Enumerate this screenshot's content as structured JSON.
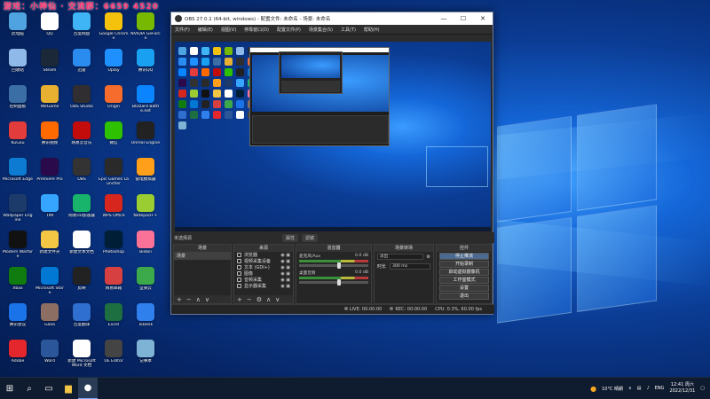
{
  "overlay": {
    "text": "游戏：小神仙 · 交流群：6659 4520"
  },
  "desktop": {
    "icons": [
      {
        "label": "此电脑",
        "color": "#4fa3e0"
      },
      {
        "label": "QQ",
        "color": "#ffffff"
      },
      {
        "label": "百度网盘",
        "color": "#3fb5f5"
      },
      {
        "label": "Google Chrome",
        "color": "#f4c20d"
      },
      {
        "label": "NVIDIA GeForce",
        "color": "#76b900"
      },
      {
        "label": "回收站",
        "color": "#8fb9e8"
      },
      {
        "label": "Steam",
        "color": "#1b2838"
      },
      {
        "label": "迅雷",
        "color": "#2b8cf0"
      },
      {
        "label": "Uplay",
        "color": "#1e90ff"
      },
      {
        "label": "腾讯QQ",
        "color": "#1aa0f0"
      },
      {
        "label": "控制面板",
        "color": "#3a6ea5"
      },
      {
        "label": "WeGame",
        "color": "#e8b030"
      },
      {
        "label": "OBS Studio",
        "color": "#302e31"
      },
      {
        "label": "Origin",
        "color": "#f56c2d"
      },
      {
        "label": "Blizzard Battle.net",
        "color": "#0a84ff"
      },
      {
        "label": "KuGou",
        "color": "#e23c3c"
      },
      {
        "label": "腾讯视频",
        "color": "#ff6a00"
      },
      {
        "label": "网易云音乐",
        "color": "#c20c0c"
      },
      {
        "label": "微信",
        "color": "#2dc100"
      },
      {
        "label": "Unreal Engine",
        "color": "#222222"
      },
      {
        "label": "Microsoft Edge",
        "color": "#0c7bd1"
      },
      {
        "label": "Premiere Pro",
        "color": "#2a0a4a"
      },
      {
        "label": "OBS",
        "color": "#333333"
      },
      {
        "label": "Epic Games Launcher",
        "color": "#2a2a2a"
      },
      {
        "label": "雷电模拟器",
        "color": "#ff9f1a"
      },
      {
        "label": "Wallpaper Engine",
        "color": "#1d3b6a"
      },
      {
        "label": "TIM",
        "color": "#35a5ff"
      },
      {
        "label": "网易UU加速器",
        "color": "#19b46c"
      },
      {
        "label": "WPS Office",
        "color": "#d7261e"
      },
      {
        "label": "Notepad++",
        "color": "#9acd32"
      },
      {
        "label": "Modern Warfare",
        "color": "#111111"
      },
      {
        "label": "新建文件夹",
        "color": "#f3c744"
      },
      {
        "label": "新建文本文档",
        "color": "#ffffff"
      },
      {
        "label": "Photoshop",
        "color": "#001e36"
      },
      {
        "label": "Bilibili",
        "color": "#fb7299"
      },
      {
        "label": "Xbox",
        "color": "#107c10"
      },
      {
        "label": "Microsoft Store",
        "color": "#0078d4"
      },
      {
        "label": "剪映",
        "color": "#222222"
      },
      {
        "label": "网易邮箱",
        "color": "#d64040"
      },
      {
        "label": "坚果云",
        "color": "#3caa4a"
      },
      {
        "label": "腾讯会议",
        "color": "#1a73e8"
      },
      {
        "label": "Gaea",
        "color": "#8d6e63"
      },
      {
        "label": "百度翻译",
        "color": "#2f6fd0"
      },
      {
        "label": "Excel",
        "color": "#1d6f42"
      },
      {
        "label": "ToDesk",
        "color": "#2f80ed"
      },
      {
        "label": "Adobe",
        "color": "#e4262d"
      },
      {
        "label": "Word",
        "color": "#2b579a"
      },
      {
        "label": "新建 Microsoft Word 文档",
        "color": "#ffffff"
      },
      {
        "label": "UE Editor",
        "color": "#444444"
      },
      {
        "label": "记事本",
        "color": "#7fb3d5"
      }
    ]
  },
  "obs": {
    "title": "OBS 27.0.1 (64-bit, windows) - 配置文件: 未命名 - 场景: 未命名",
    "window_controls": [
      "—",
      "☐",
      "✕"
    ],
    "menu": [
      "文件(F)",
      "编辑(E)",
      "视图(V)",
      "停靠窗口(D)",
      "配置文件(P)",
      "场景集合(S)",
      "工具(T)",
      "帮助(H)"
    ],
    "scene_bar": {
      "label": "未选择源",
      "properties": "属性",
      "filters": "滤镜"
    },
    "docks": {
      "scenes": {
        "title": "场景",
        "items": [
          "场景"
        ]
      },
      "sources": {
        "title": "来源",
        "items": [
          "浏览器",
          "视频采集设备",
          "文本 (GDI+)",
          "图像",
          "音频采集",
          "显示器采集"
        ]
      },
      "mixer": {
        "title": "混音器",
        "tracks": [
          {
            "name": "麦克风/Aux",
            "db": "0.0 dB"
          },
          {
            "name": "桌面音频",
            "db": "0.0 dB"
          }
        ]
      },
      "transitions": {
        "title": "场景转场",
        "type": "淡出",
        "duration_label": "时长",
        "duration_value": "300 ms"
      },
      "controls": {
        "title": "控件",
        "buttons": [
          "停止推流",
          "开始录制",
          "启动虚拟摄像机",
          "工作室模式",
          "设置",
          "退出"
        ]
      }
    },
    "status": {
      "live": "LIVE: 00:00:00",
      "rec": "REC: 00:00:00",
      "cpu": "CPU: 0.3%, 60.00 fps"
    }
  },
  "taskbar": {
    "weather": "10°C 晴朗",
    "lang": "ENG",
    "time": "12:41 周六",
    "date": "2022/12/31"
  }
}
